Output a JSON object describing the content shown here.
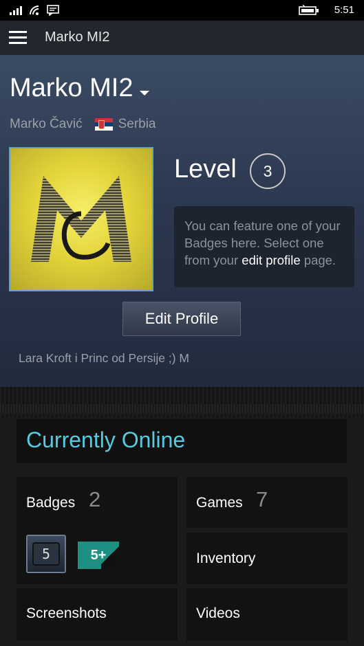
{
  "status_bar": {
    "time": "5:51"
  },
  "app_bar": {
    "title": "Marko MI2"
  },
  "profile": {
    "persona_name": "Marko MI2",
    "real_name": "Marko Čavić",
    "country": "Serbia",
    "level_label": "Level",
    "level_value": "3",
    "feature_text_before": "You can feature one of your Badges here. Select one from your ",
    "feature_link": "edit profile",
    "feature_text_after": " page.",
    "edit_button": "Edit Profile",
    "summary": "Lara Kroft i Princ od Persije ;) M"
  },
  "online_status": "Currently Online",
  "tiles": {
    "badges": {
      "label": "Badges",
      "count": "2",
      "badge_icons": [
        "5",
        "5+"
      ]
    },
    "games": {
      "label": "Games",
      "count": "7"
    },
    "inventory": {
      "label": "Inventory"
    },
    "screenshots": {
      "label": "Screenshots"
    },
    "videos": {
      "label": "Videos"
    }
  },
  "colors": {
    "accent_online": "#57cbde",
    "profile_bg": "#2c3850",
    "tile_bg": "#121212"
  }
}
